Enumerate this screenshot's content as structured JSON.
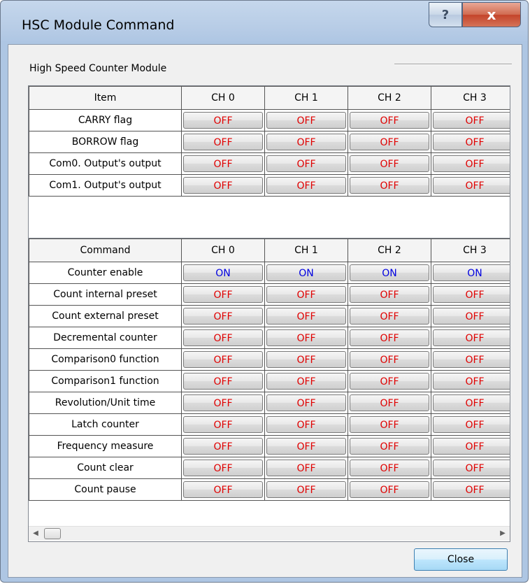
{
  "window": {
    "title": "HSC Module Command",
    "help_glyph": "?",
    "close_glyph": "x"
  },
  "group_label": "High Speed Counter Module",
  "colors": {
    "off_text": "#e00000",
    "on_text": "#0000e0"
  },
  "status_table": {
    "columns": [
      "Item",
      "CH 0",
      "CH 1",
      "CH 2",
      "CH 3"
    ],
    "rows": [
      {
        "label": "CARRY flag",
        "values": [
          "OFF",
          "OFF",
          "OFF",
          "OFF"
        ]
      },
      {
        "label": "BORROW flag",
        "values": [
          "OFF",
          "OFF",
          "OFF",
          "OFF"
        ]
      },
      {
        "label": "Com0. Output's output",
        "values": [
          "OFF",
          "OFF",
          "OFF",
          "OFF"
        ]
      },
      {
        "label": "Com1. Output's output",
        "values": [
          "OFF",
          "OFF",
          "OFF",
          "OFF"
        ]
      }
    ]
  },
  "command_table": {
    "columns": [
      "Command",
      "CH 0",
      "CH 1",
      "CH 2",
      "CH 3"
    ],
    "rows": [
      {
        "label": "Counter enable",
        "values": [
          "ON",
          "ON",
          "ON",
          "ON"
        ]
      },
      {
        "label": "Count internal preset",
        "values": [
          "OFF",
          "OFF",
          "OFF",
          "OFF"
        ]
      },
      {
        "label": "Count external preset",
        "values": [
          "OFF",
          "OFF",
          "OFF",
          "OFF"
        ]
      },
      {
        "label": "Decremental counter",
        "values": [
          "OFF",
          "OFF",
          "OFF",
          "OFF"
        ]
      },
      {
        "label": "Comparison0 function",
        "values": [
          "OFF",
          "OFF",
          "OFF",
          "OFF"
        ]
      },
      {
        "label": "Comparison1 function",
        "values": [
          "OFF",
          "OFF",
          "OFF",
          "OFF"
        ]
      },
      {
        "label": "Revolution/Unit time",
        "values": [
          "OFF",
          "OFF",
          "OFF",
          "OFF"
        ]
      },
      {
        "label": "Latch counter",
        "values": [
          "OFF",
          "OFF",
          "OFF",
          "OFF"
        ]
      },
      {
        "label": "Frequency measure",
        "values": [
          "OFF",
          "OFF",
          "OFF",
          "OFF"
        ]
      },
      {
        "label": "Count clear",
        "values": [
          "OFF",
          "OFF",
          "OFF",
          "OFF"
        ]
      },
      {
        "label": "Count pause",
        "values": [
          "OFF",
          "OFF",
          "OFF",
          "OFF"
        ]
      }
    ]
  },
  "scrollbar_icons": [
    "scroll-left-icon",
    "scroll-right-icon"
  ],
  "footer": {
    "close_label": "Close"
  }
}
